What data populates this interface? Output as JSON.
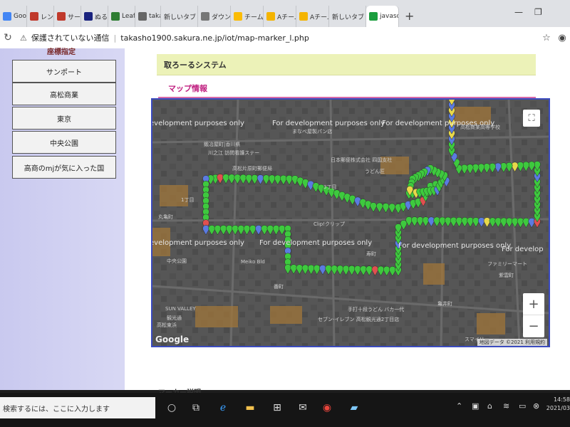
{
  "browser": {
    "tabs": [
      {
        "label": "Goog",
        "icon": "google-icon",
        "color": "#4285f4",
        "active": false
      },
      {
        "label": "レンタ",
        "icon": "app-icon",
        "color": "#c0392b",
        "active": false
      },
      {
        "label": "サーバ",
        "icon": "app-icon",
        "color": "#c0392b",
        "active": false
      },
      {
        "label": "ぬるぬ",
        "icon": "app-icon",
        "color": "#1a237e",
        "active": false
      },
      {
        "label": "Leafle",
        "icon": "leaf-icon",
        "color": "#2e7d32",
        "active": false
      },
      {
        "label": "takas",
        "icon": "globe-icon",
        "color": "#666666",
        "active": false
      },
      {
        "label": "新しいタブ",
        "icon": "",
        "color": "",
        "active": false
      },
      {
        "label": "ダウン(",
        "icon": "doc-icon",
        "color": "#777777",
        "active": false
      },
      {
        "label": "チーム",
        "icon": "drive-icon",
        "color": "#fbbc04",
        "active": false
      },
      {
        "label": "Aチーム",
        "icon": "slides-icon",
        "color": "#f4b400",
        "active": false
      },
      {
        "label": "Aチーム",
        "icon": "slides-icon",
        "color": "#f4b400",
        "active": false
      },
      {
        "label": "新しいタブ",
        "icon": "",
        "color": "",
        "active": false
      },
      {
        "label": "javasc",
        "icon": "js-icon",
        "color": "#1b9e3e",
        "active": true
      }
    ],
    "new_tab": "+",
    "security_label": "保護されていない通信",
    "url": "takasho1900.sakura.ne.jp/iot/map-marker_l.php"
  },
  "sidebar": {
    "title": "座標指定",
    "items": [
      "サンポート",
      "高松商業",
      "東京",
      "中央公園",
      "高商のmjが気に入った国"
    ]
  },
  "main": {
    "system_title": "取ろーるシステム",
    "map_section_label": "マップ情報",
    "marker_section_label": "マーカー説明"
  },
  "map": {
    "dev_watermark": "For development purposes only",
    "dev_watermark_partial_left": "evelopment purposes only",
    "dev_watermark_partial_right": "For develop",
    "google_logo": "Google",
    "attribution": "地図データ ©2021  利用規約",
    "zoom_in": "+",
    "zoom_out": "−",
    "places": {
      "p1": "まなべ屋製パン店",
      "p2": "鍛冶屋町|香川県",
      "p3": "川之江 訪問看護ステー",
      "p4": "高松片原町郵便局",
      "p5": "日本郵便株式会社 四国支社",
      "p6": "高松商業高等学校",
      "p7": "3丁目",
      "p8": "うどん匠",
      "p9": "Clip!クリップ",
      "p10": "中央公園",
      "p11": "Meiko Bld",
      "p12": "SUN VALLEY",
      "p13": "観光通",
      "p14": "セブン-イレブン 高松観光通2丁目店",
      "p15": "手打十段うどん バカ一代",
      "p16": "ファミリーマート",
      "p17": "スマイリー",
      "p18": "高松東浜",
      "p19": "1丁目",
      "p20": "丸亀町",
      "p21": "寿町",
      "p22": "番町",
      "p23": "亀井町",
      "p24": "紫雲町"
    },
    "marker_colors": {
      "green": "#3ec93e",
      "blue": "#5b7be0",
      "yellow": "#e8d84a",
      "red": "#e05050"
    }
  },
  "taskbar": {
    "search_placeholder": "検索するには、ここに入力します",
    "clock_time": "14:58",
    "clock_date": "2021/03"
  }
}
